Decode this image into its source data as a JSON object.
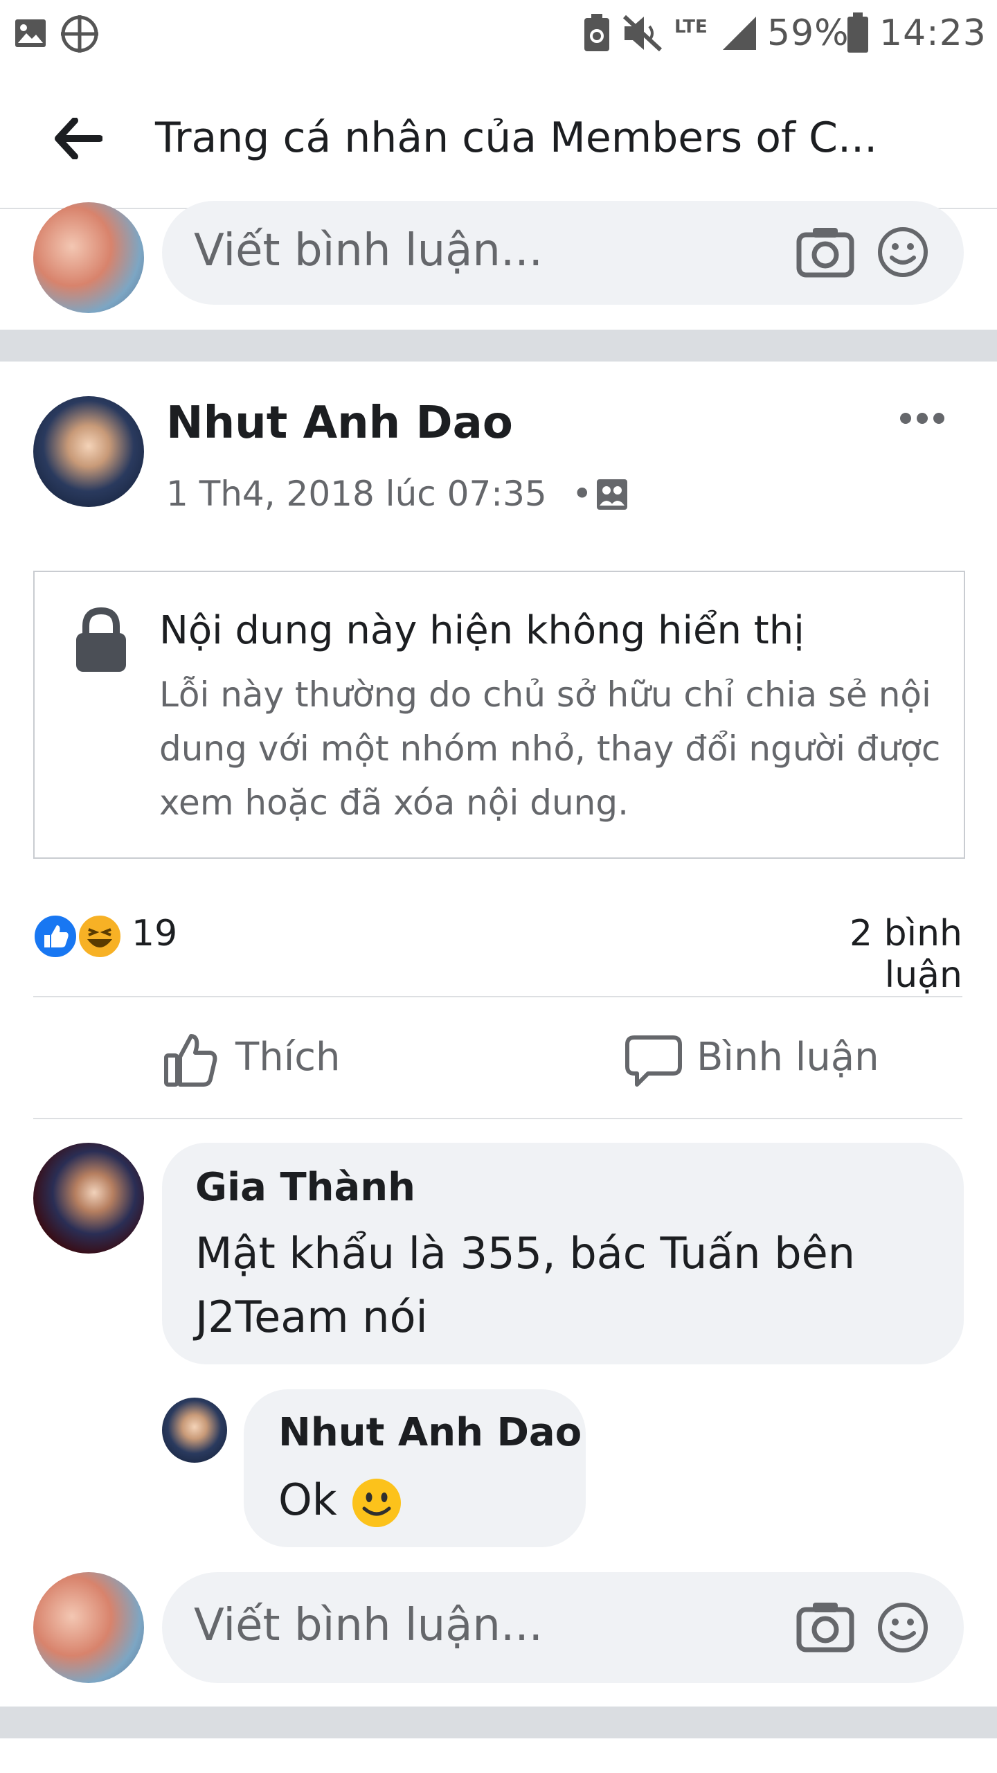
{
  "status_bar": {
    "lte_label": "LTE",
    "battery": "59%",
    "time": "14:23"
  },
  "header": {
    "title": "Trang cá nhân của Members of C..."
  },
  "top_comment_input": {
    "placeholder": "Viết bình luận..."
  },
  "post": {
    "author": "Nhut Anh Dao",
    "timestamp": "1 Th4, 2018 lúc 07:35",
    "separator": "•",
    "locked": {
      "title": "Nội dung này hiện không hiển thị",
      "description": "Lỗi này thường do chủ sở hữu chỉ chia sẻ nội dung với một nhóm nhỏ, thay đổi người được xem hoặc đã xóa nội dung."
    },
    "reaction_count": "19",
    "comment_count": "2 bình luận",
    "actions": {
      "like": "Thích",
      "comment": "Bình luận"
    }
  },
  "comments": [
    {
      "author": "Gia Thành",
      "text": "Mật khẩu là 355, bác Tuấn bên J2Team nói"
    },
    {
      "author": "Nhut Anh Dao",
      "text": "Ok"
    }
  ],
  "bottom_comment_input": {
    "placeholder": "Viết bình luận..."
  },
  "colors": {
    "like_blue": "#1877f2",
    "haha_yellow": "#f7b125",
    "input_bg": "#f0f2f5",
    "band_gray": "#dadde1"
  }
}
